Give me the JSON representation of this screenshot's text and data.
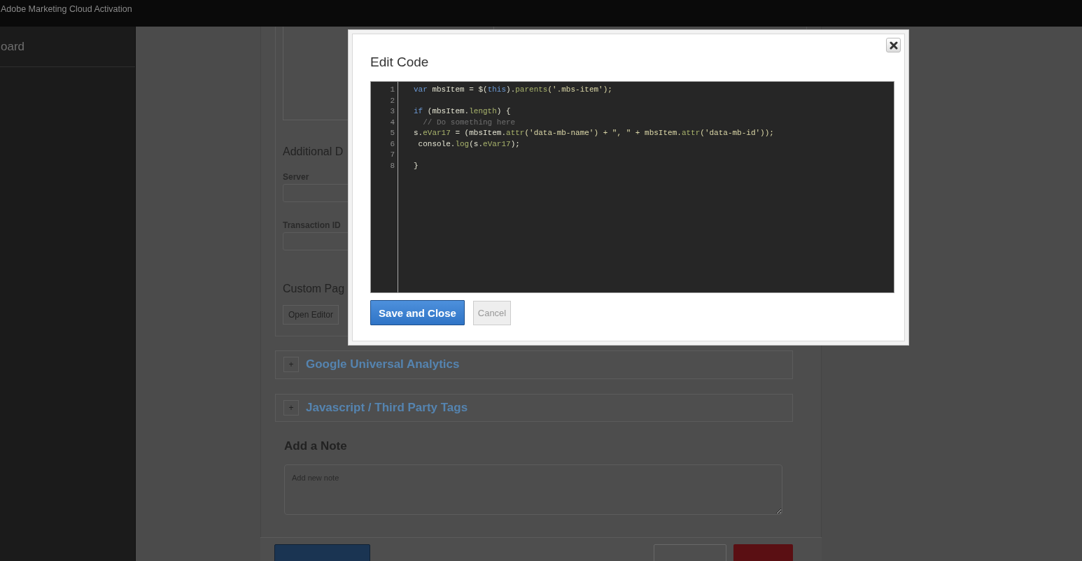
{
  "header": {
    "title": "Adobe Marketing Cloud Activation"
  },
  "sidebar": {
    "items": [
      {
        "label": "oard"
      }
    ]
  },
  "form": {
    "additional_heading": "Additional D",
    "fields": [
      {
        "label": "Server"
      },
      {
        "label": "Transaction ID"
      }
    ],
    "custom_heading": "Custom Pag",
    "open_editor": "Open Editor"
  },
  "sections": [
    {
      "toggle": "+",
      "title": "Google Universal Analytics",
      "expanded": false
    },
    {
      "toggle": "+",
      "title": "Javascript / Third Party Tags",
      "expanded": false
    }
  ],
  "note": {
    "heading": "Add a Note",
    "placeholder": "Add new note"
  },
  "modal": {
    "title": "Edit Code",
    "lines": [
      {
        "number": "1",
        "tokens": [
          {
            "text": "var",
            "kind": "keyword"
          },
          {
            "text": " mbsItem = $(",
            "kind": "plain"
          },
          {
            "text": "this",
            "kind": "keyword"
          },
          {
            "text": ").",
            "kind": "plain"
          },
          {
            "text": "parents",
            "kind": "member"
          },
          {
            "text": "('.mbs-item');",
            "kind": "string"
          }
        ]
      },
      {
        "number": "2"
      },
      {
        "number": "3",
        "tokens": [
          {
            "text": "if",
            "kind": "keyword"
          },
          {
            "text": " (mbsItem.",
            "kind": "plain"
          },
          {
            "text": "length",
            "kind": "member"
          },
          {
            "text": ") {",
            "kind": "plain"
          }
        ]
      },
      {
        "number": "4",
        "tokens": [
          {
            "text": "  // Do something here",
            "kind": "comment"
          }
        ]
      },
      {
        "number": "5",
        "tokens": [
          {
            "text": "s.",
            "kind": "plain"
          },
          {
            "text": "eVar17",
            "kind": "member"
          },
          {
            "text": " = (mbsItem.",
            "kind": "plain"
          },
          {
            "text": "attr",
            "kind": "member"
          },
          {
            "text": "('data-mb-name') + \", \" + mbsItem.",
            "kind": "string"
          },
          {
            "text": "attr",
            "kind": "member"
          },
          {
            "text": "('data-mb-id'));",
            "kind": "string"
          }
        ]
      },
      {
        "number": "6",
        "tokens": [
          {
            "text": " console.",
            "kind": "plain"
          },
          {
            "text": "log",
            "kind": "member"
          },
          {
            "text": "(s.",
            "kind": "plain"
          },
          {
            "text": "eVar17",
            "kind": "member"
          },
          {
            "text": ");",
            "kind": "plain"
          }
        ]
      },
      {
        "number": "7"
      },
      {
        "number": "8",
        "tokens": [
          {
            "text": "}",
            "kind": "plain"
          }
        ]
      }
    ],
    "save_label": "Save and Close",
    "cancel_label": "Cancel"
  }
}
